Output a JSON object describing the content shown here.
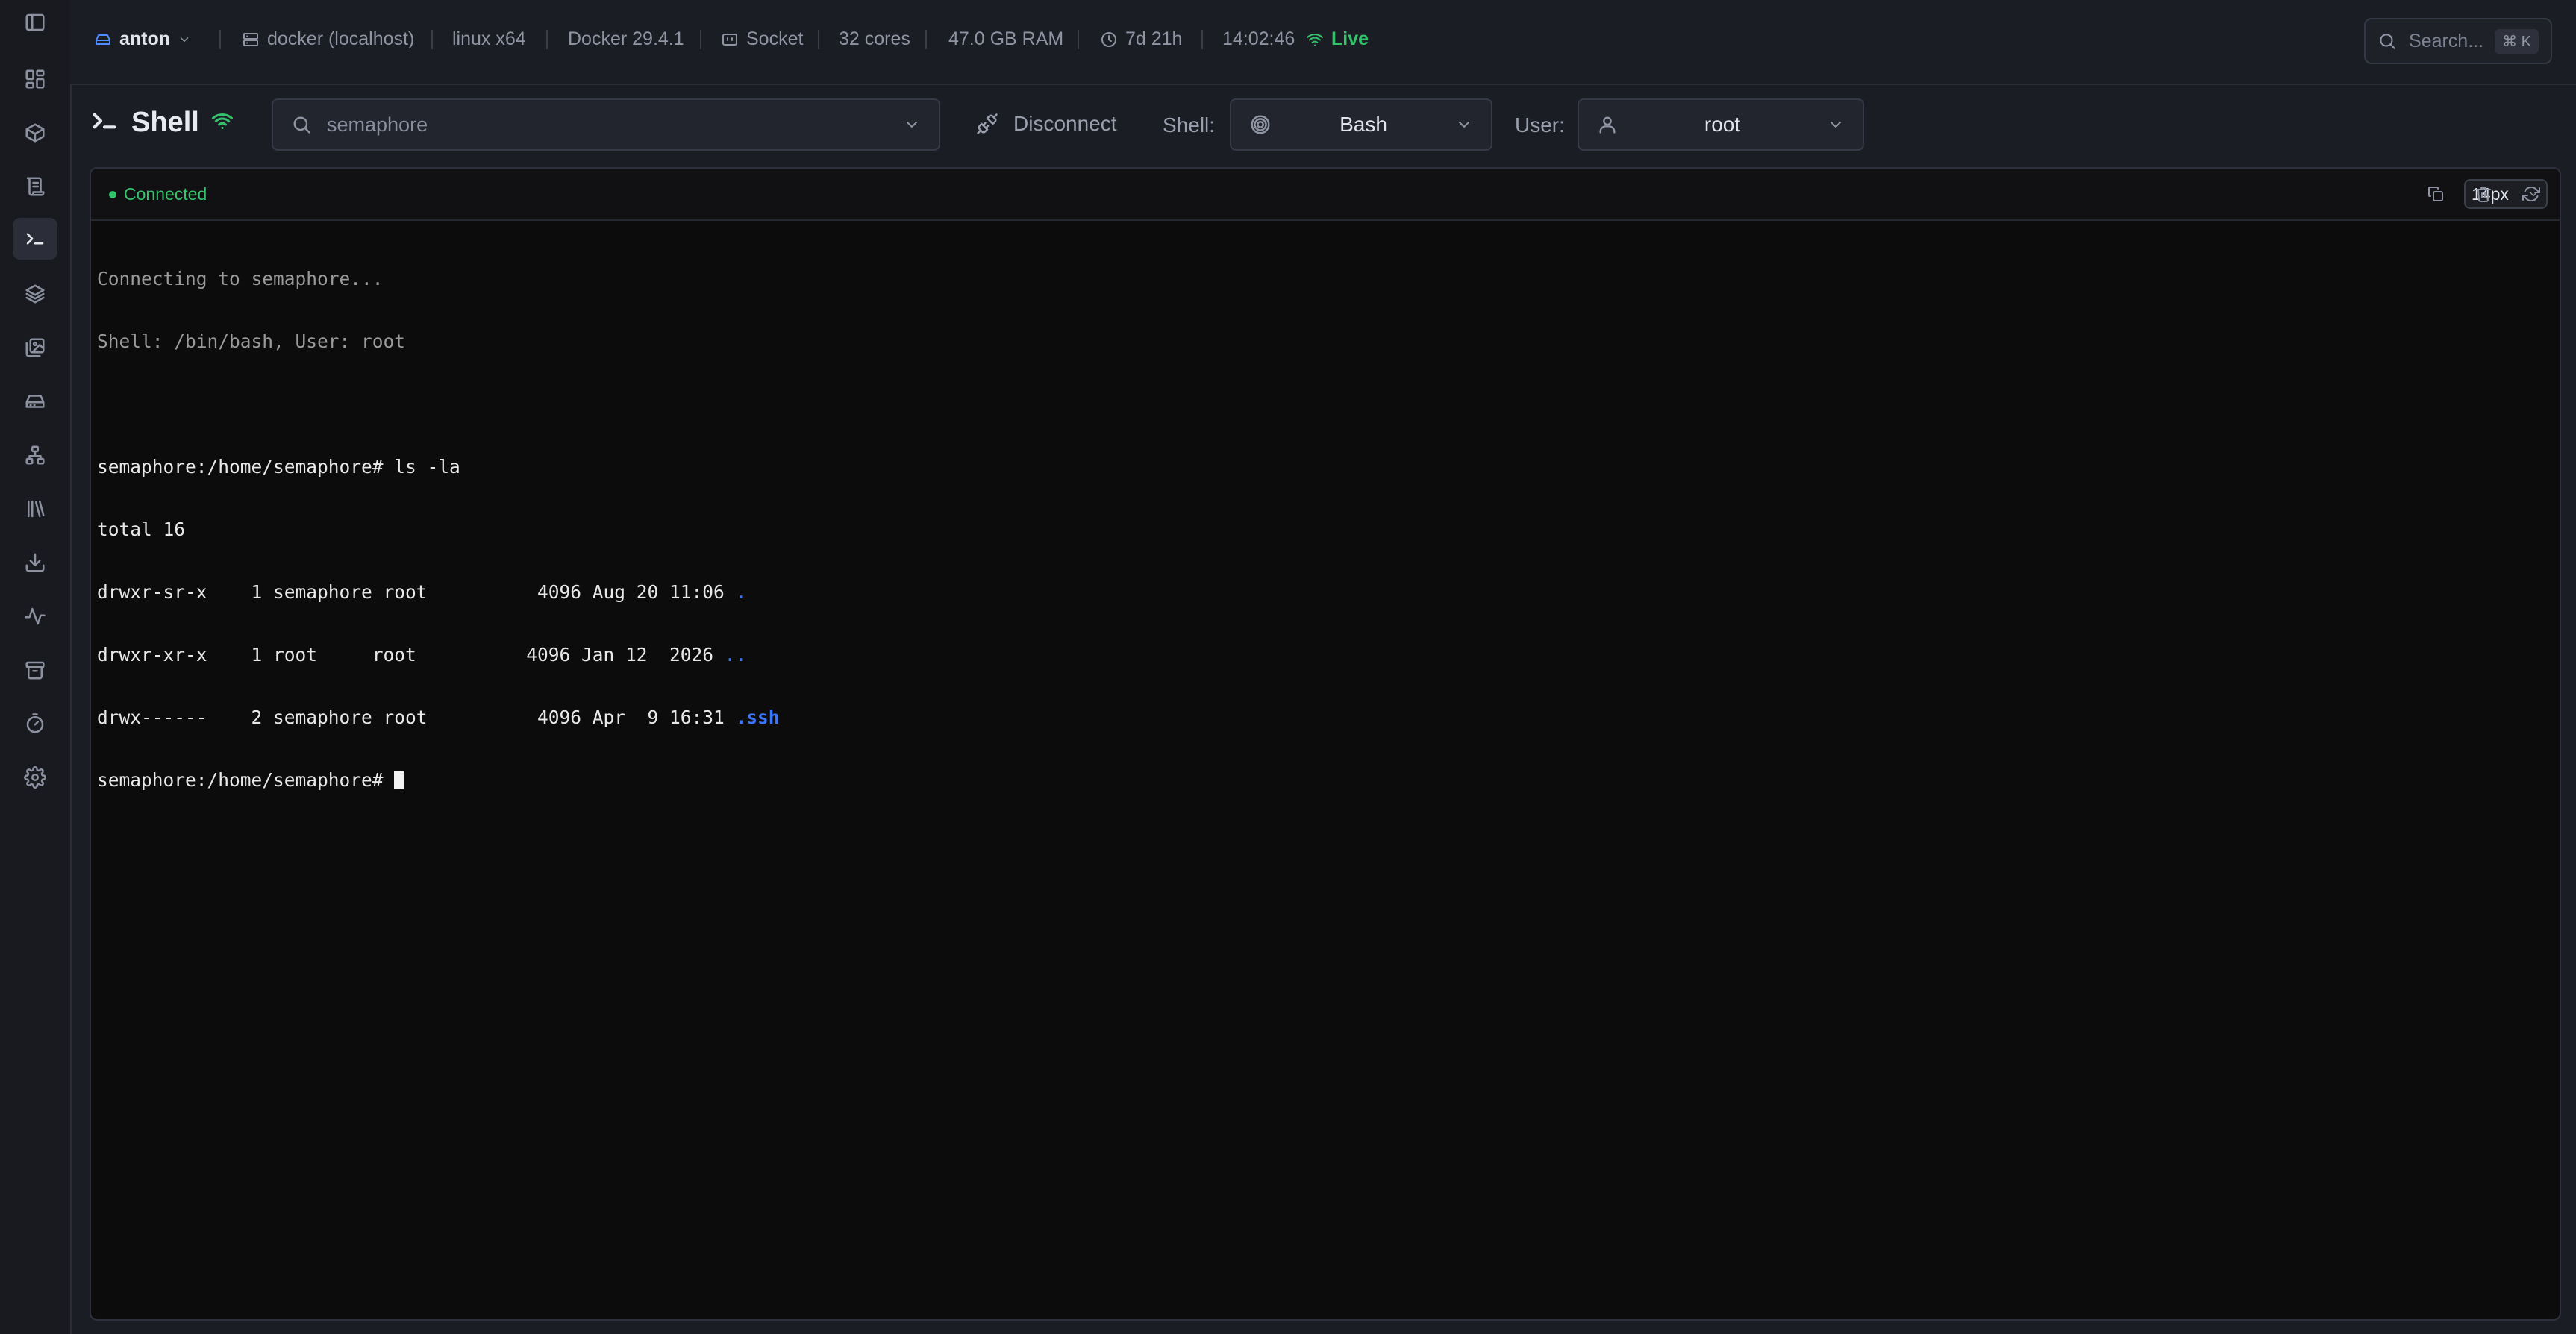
{
  "sidebar": {
    "items": [
      {
        "icon": "panel-toggle-icon",
        "active": false
      },
      {
        "icon": "dashboard-icon",
        "active": false
      },
      {
        "icon": "container-box-icon",
        "active": false
      },
      {
        "icon": "scroll-logs-icon",
        "active": false
      },
      {
        "icon": "terminal-icon",
        "active": true
      },
      {
        "icon": "layers-icon",
        "active": false
      },
      {
        "icon": "images-icon",
        "active": false
      },
      {
        "icon": "drive-icon",
        "active": false
      },
      {
        "icon": "network-icon",
        "active": false
      },
      {
        "icon": "library-icon",
        "active": false
      },
      {
        "icon": "download-icon",
        "active": false
      },
      {
        "icon": "activity-icon",
        "active": false
      },
      {
        "icon": "archive-icon",
        "active": false
      },
      {
        "icon": "timer-icon",
        "active": false
      },
      {
        "icon": "settings-icon",
        "active": false
      }
    ]
  },
  "topbar": {
    "user": "anton",
    "host": "docker (localhost)",
    "platform": "linux x64",
    "docker_version": "Docker 29.4.1",
    "connection": "Socket",
    "cores": "32 cores",
    "ram": "47.0 GB RAM",
    "uptime": "7d 21h",
    "time": "14:02:46",
    "live": "Live",
    "search_placeholder": "Search...",
    "search_shortcut": "⌘ K"
  },
  "toolbar": {
    "title": "Shell",
    "container_value": "semaphore",
    "disconnect_label": "Disconnect",
    "shell_label": "Shell:",
    "shell_value": "Bash",
    "user_label": "User:",
    "user_value": "root"
  },
  "terminal": {
    "status": "Connected",
    "font_size": "14px",
    "lines": {
      "l1": "Connecting to semaphore...",
      "l2": "Shell: /bin/bash, User: root",
      "l3": "",
      "l4": "semaphore:/home/semaphore# ls -la",
      "l5": "total 16",
      "l6_text": "drwxr-sr-x    1 semaphore root          4096 Aug 20 11:06 ",
      "l6_name": ".",
      "l7_text": "drwxr-xr-x    1 root     root          4096 Jan 12  2026 ",
      "l7_name": "..",
      "l8_text": "drwx------    2 semaphore root          4096 Apr  9 16:31 ",
      "l8_name": ".ssh",
      "l9": "semaphore:/home/semaphore# "
    }
  },
  "colors": {
    "accent_live": "#34c26b",
    "dir_blue": "#3b78ff",
    "terminal_bg": "#0c0c0c",
    "app_bg": "#1b1d24"
  }
}
